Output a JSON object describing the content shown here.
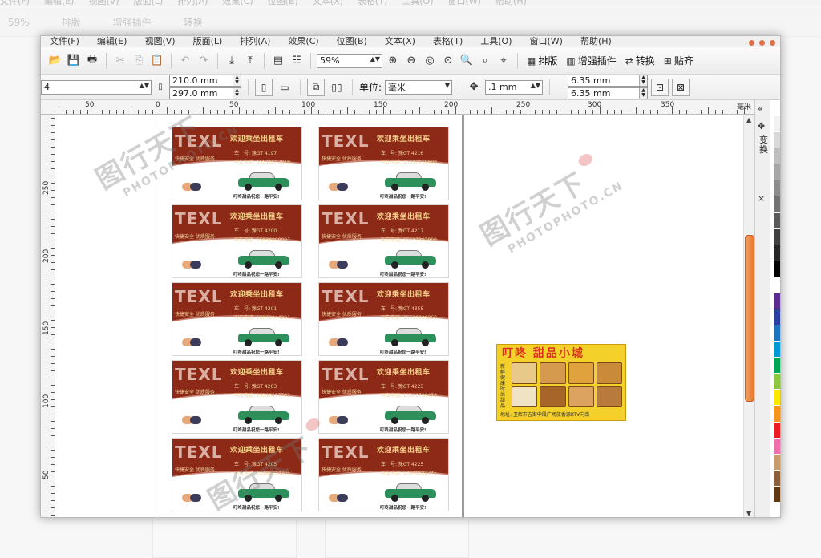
{
  "app": {
    "menus": [
      "文件(F)",
      "编辑(E)",
      "视图(V)",
      "版面(L)",
      "排列(A)",
      "效果(C)",
      "位图(B)",
      "文本(X)",
      "表格(T)",
      "工具(O)",
      "窗口(W)",
      "帮助(H)"
    ],
    "background_menus": [
      "文件(F)",
      "编辑(E)",
      "视图(V)",
      "版面(L)",
      "排列(A)",
      "效果(C)",
      "位图(B)",
      "文本(X)",
      "表格(T)",
      "工具(O)",
      "窗口(W)",
      "帮助(H)"
    ]
  },
  "toolbar": {
    "zoom_value": "59%",
    "layout_label": "排版",
    "plugin_label": "增强插件",
    "convert_label": "转换",
    "paste_label": "贴齐",
    "background_zoom": "59%"
  },
  "property_bar": {
    "preset_value": "4",
    "width_value": "210.0 mm",
    "height_value": "297.0 mm",
    "unit_label": "单位:",
    "unit_value": "毫米",
    "nudge_value": ".1 mm",
    "dup_x_value": "6.35 mm",
    "dup_y_value": "6.35 mm"
  },
  "rulers": {
    "h_labels": [
      "50",
      "0",
      "50",
      "100",
      "150",
      "200",
      "250",
      "300",
      "350",
      "毫米"
    ],
    "v_labels": [
      "250",
      "200",
      "150",
      "100",
      "50"
    ]
  },
  "dock": {
    "collapse_glyph": "«",
    "tab_label": "变换",
    "close_glyph": "×"
  },
  "taxi_cards": [
    {
      "texl": "TEXL",
      "welcome": "欢迎乘坐出租车",
      "slogan": "快捷安全  优质服务",
      "plate": "车　号: 豫GT 4197",
      "phone": "叫车电话: 15516503818",
      "footer": "叮咚甜品祝您一路平安!"
    },
    {
      "texl": "TEXL",
      "welcome": "欢迎乘坐出租车",
      "slogan": "快捷安全  优质服务",
      "plate": "车　号: 豫GT 4216",
      "phone": "叫车电话: 15617115608",
      "footer": "叮咚甜品祝您一路平安!"
    },
    {
      "texl": "TEXL",
      "welcome": "欢迎乘坐出租车",
      "slogan": "快捷安全  优质服务",
      "plate": "车　号: 豫GT 4200",
      "phone": "叫车电话: 15936009097",
      "footer": "叮咚甜品祝您一路平安!"
    },
    {
      "texl": "TEXL",
      "welcome": "欢迎乘坐出租车",
      "slogan": "快捷安全  优质服务",
      "plate": "车　号: 豫GT 4217",
      "phone": "叫车电话: 15637367909",
      "footer": "叮咚甜品祝您一路平安!"
    },
    {
      "texl": "TEXL",
      "welcome": "欢迎乘坐出租车",
      "slogan": "快捷安全  优质服务",
      "plate": "车　号: 豫GT 4201",
      "phone": "叫车电话: 13072644291",
      "footer": "叮咚甜品祝您一路平安!"
    },
    {
      "texl": "TEXL",
      "welcome": "欢迎乘坐出租车",
      "slogan": "快捷安全  优质服务",
      "plate": "车　号: 豫GT 4355",
      "phone": "叫车电话: 15516626268",
      "footer": "叮咚甜品祝您一路平安!"
    },
    {
      "texl": "TEXL",
      "welcome": "欢迎乘坐出租车",
      "slogan": "快捷安全  优质服务",
      "plate": "车　号: 豫GT 4203",
      "phone": "叫车电话: 15516457762",
      "footer": "叮咚甜品祝您一路平安!"
    },
    {
      "texl": "TEXL",
      "welcome": "欢迎乘坐出租车",
      "slogan": "快捷安全  优质服务",
      "plate": "车　号: 豫GT 4223",
      "phone": "叫车电话: 13503739478",
      "footer": "叮咚甜品祝您一路平安!"
    },
    {
      "texl": "TEXL",
      "welcome": "欢迎乘坐出租车",
      "slogan": "快捷安全  优质服务",
      "plate": "车　号: 豫GT 4205",
      "phone": "叫车电话: 13183114205",
      "footer": "叮咚甜品祝您一路平安!"
    },
    {
      "texl": "TEXL",
      "welcome": "欢迎乘坐出租车",
      "slogan": "快捷安全  优质服务",
      "plate": "车　号: 豫GT 4225",
      "phone": "叫车电话: 13949632745",
      "footer": "叮咚甜品祝您一路平安!"
    }
  ],
  "promo_card": {
    "title": "叮咚 甜品小城",
    "side_text": "新鲜健康 时尚甜品",
    "address": "地址: 卫辉市吉街中段广场旅香源KTV向南"
  },
  "watermark": {
    "text_cn": "图行天下",
    "text_en": "PHOTOPHOTO.CN"
  },
  "colors": {
    "taxi_band": "#8c2a17",
    "promo_bg": "#f3d02a",
    "scroll_thumb": "#e8772e",
    "palette": [
      "#ffffff",
      "#f2f2f2",
      "#d9d9d9",
      "#bfbfbf",
      "#a6a6a6",
      "#8c8c8c",
      "#737373",
      "#595959",
      "#404040",
      "#262626",
      "#000000",
      "#ffffff",
      "#5b2d90",
      "#2b3f9e",
      "#1c75bc",
      "#009bd5",
      "#00a651",
      "#8dc63f",
      "#ffe800",
      "#f7941d",
      "#ed1c24",
      "#f06eaa",
      "#c69c6d",
      "#8b5e3c",
      "#603913",
      "#ffffff"
    ]
  }
}
